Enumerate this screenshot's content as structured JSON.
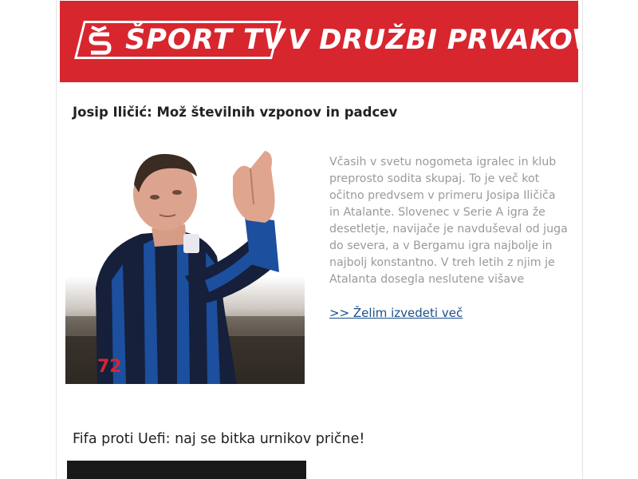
{
  "banner": {
    "logo_text": "ŠPORT TV",
    "slogan": "V DRUŽBI PRVAKOV!",
    "background_color": "#d8262f"
  },
  "articles": [
    {
      "title": "Josip Iličić: Mož številnih vzponov in padcev",
      "excerpt": "Včasih v svetu nogometa igralec in klub preprosto sodita skupaj. To je več kot očitno predvsem v primeru Josipa Iličiča in Atalante. Slovenec v Serie A igra že desetletje, navijače je navduševal od juga do severa, a v Bergamu igra najbolje in najbolj konstantno. V treh letih z njim je Atalanta dosegla neslutene višave",
      "link_text": ">> Želim izvedeti več",
      "jersey_number": "72"
    },
    {
      "title": "Fifa proti Uefi: naj se bitka urnikov prične!"
    }
  ],
  "colors": {
    "link": "#1a4f8a",
    "excerpt_text": "#9a9a9a"
  }
}
